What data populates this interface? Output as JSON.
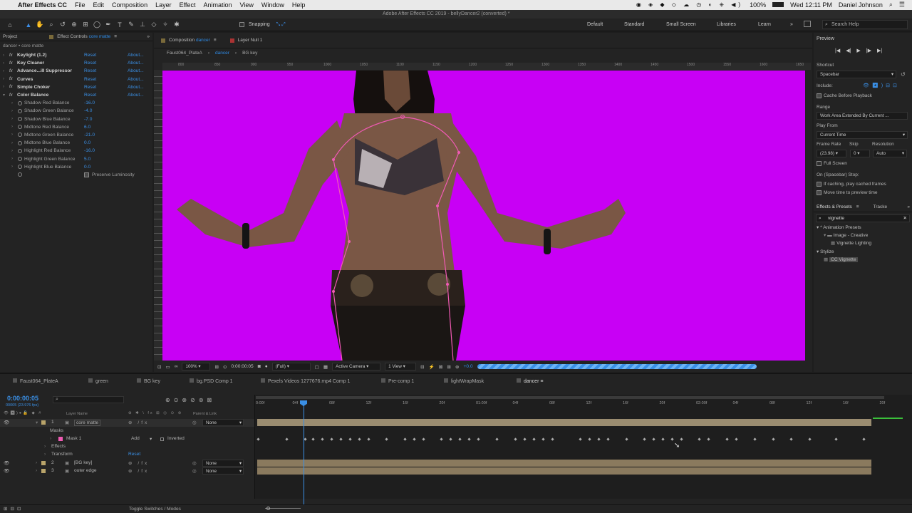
{
  "menubar": {
    "app": "After Effects CC",
    "items": [
      "File",
      "Edit",
      "Composition",
      "Layer",
      "Effect",
      "Animation",
      "View",
      "Window",
      "Help"
    ],
    "window_title": "Adobe After Effects CC 2019 - bellyDancer2 (converted) *",
    "battery": "100%",
    "clock": "Wed 12:11 PM",
    "user": "Daniel Johnson"
  },
  "toolbar": {
    "snapping": "Snapping",
    "workspaces": [
      "Default",
      "Standard",
      "Small Screen",
      "Libraries",
      "Learn"
    ],
    "search_placeholder": "Search Help"
  },
  "effect_controls": {
    "tab_project": "Project",
    "tab_label": "Effect Controls",
    "tab_layer": "core matte",
    "breadcrumb": "dancer • core matte",
    "reset": "Reset",
    "about": "About...",
    "effects": [
      "Keylight (1.2)",
      "Key Cleaner",
      "Advance...ill Suppressor",
      "Curves",
      "Simple Choker",
      "Color Balance"
    ],
    "params": [
      {
        "name": "Shadow Red Balance",
        "value": "-16.0"
      },
      {
        "name": "Shadow Green Balance",
        "value": "-4.0"
      },
      {
        "name": "Shadow Blue Balance",
        "value": "-7.0"
      },
      {
        "name": "Midtone Red Balance",
        "value": "6.0"
      },
      {
        "name": "Midtone Green Balance",
        "value": "-21.0"
      },
      {
        "name": "Midtone Blue Balance",
        "value": "0.0"
      },
      {
        "name": "Highlight Red Balance",
        "value": "-16.0"
      },
      {
        "name": "Highlight Green Balance",
        "value": "5.0"
      },
      {
        "name": "Highlight Blue Balance",
        "value": "0.0"
      }
    ],
    "preserve": "Preserve Luminosity"
  },
  "composition": {
    "tab_prefix": "Composition",
    "tab_name": "dancer",
    "layer_tab": "Layer Null 1",
    "crumbs": [
      "Faust064_PlateA",
      "dancer",
      "BG key"
    ],
    "ruler_labels": [
      "800",
      "850",
      "900",
      "950",
      "1000",
      "1050",
      "1100",
      "1150",
      "1200",
      "1250",
      "1300",
      "1350",
      "1400",
      "1450",
      "1500",
      "1550",
      "1600",
      "1650",
      "1700",
      "1750"
    ],
    "bg_color": "#c800f5",
    "zoom": "100%",
    "timecode": "0:00:00:05",
    "resolution": "(Full)",
    "camera": "Active Camera",
    "view": "1 View",
    "exposure": "+0.0"
  },
  "preview": {
    "title": "Preview",
    "shortcut_label": "Shortcut",
    "shortcut": "Spacebar",
    "include": "Include:",
    "cache_before": "Cache Before Playback",
    "range_label": "Range",
    "range": "Work Area Extended By Current ...",
    "play_from_label": "Play From",
    "play_from": "Current Time",
    "frame_rate_label": "Frame Rate",
    "skip_label": "Skip",
    "resolution_label": "Resolution",
    "frame_rate": "(23.98)",
    "skip": "0",
    "resolution": "Auto",
    "full_screen": "Full Screen",
    "on_stop": "On (Spacebar) Stop:",
    "if_caching": "If caching, play cached frames",
    "move_time": "Move time to preview time"
  },
  "effects_presets": {
    "tab": "Effects & Presets",
    "tab2": "Tracke",
    "search": "vignette",
    "tree": [
      {
        "label": "* Animation Presets",
        "indent": 0
      },
      {
        "label": "Image - Creative",
        "indent": 1
      },
      {
        "label": "Vignette Lighting",
        "indent": 2
      },
      {
        "label": "Stylize",
        "indent": 0
      },
      {
        "label": "CC Vignette",
        "indent": 1
      }
    ]
  },
  "timeline": {
    "tabs": [
      "Faust064_PlateA",
      "green",
      "BG key",
      "bg.PSD Comp 1",
      "Pexels Videos 1277676.mp4 Comp 1",
      "Pre-comp 1",
      "lightWrapMask",
      "dancer"
    ],
    "active_tab": "dancer",
    "timecode": "0:00:00:05",
    "fps": "00005 (23.976 fps)",
    "col_layer_name": "Layer Name",
    "col_parent": "Parent & Link",
    "ruler": [
      "0:00f",
      "04f",
      "08f",
      "12f",
      "16f",
      "20f",
      "01:00f",
      "04f",
      "08f",
      "12f",
      "16f",
      "20f",
      "02:00f",
      "04f",
      "08f",
      "12f",
      "16f",
      "20f"
    ],
    "layers": [
      {
        "num": "1",
        "name": "core matte",
        "parent": "None"
      },
      {
        "num": "2",
        "name": "[BG key]",
        "parent": "None"
      },
      {
        "num": "3",
        "name": "outer edge",
        "parent": "None"
      }
    ],
    "masks": "Masks",
    "mask1": "Mask 1",
    "mask_mode": "Add",
    "inverted": "Inverted",
    "effects": "Effects",
    "transform": "Transform",
    "reset": "Reset",
    "toggle": "Toggle Switches / Modes"
  }
}
